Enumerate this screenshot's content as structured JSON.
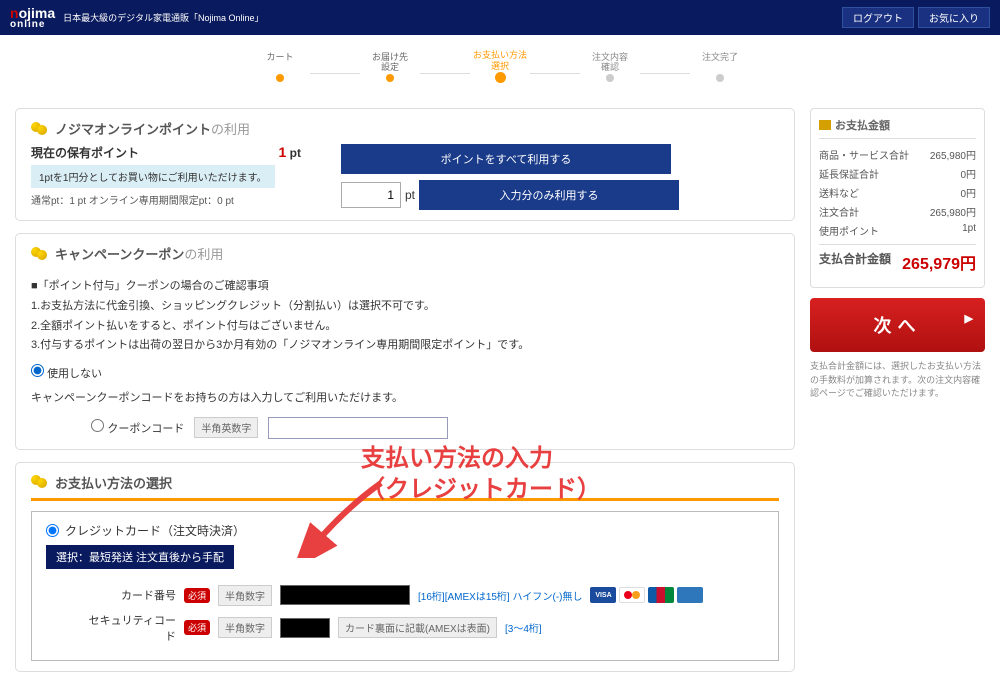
{
  "header": {
    "tagline": "日本最大級のデジタル家電通販「Nojima Online」",
    "logout": "ログアウト",
    "favorites": "お気に入り"
  },
  "progress": {
    "steps": [
      "カート",
      "お届け先\n設定",
      "お支払い方法\n選択",
      "注文内容\n確認",
      "注文完了"
    ]
  },
  "points": {
    "title_main": "ノジマオンラインポイント",
    "title_suffix": "の利用",
    "current_label": "現在の保有ポイント",
    "current_value": "1",
    "pt_unit": "pt",
    "note": "1ptを1円分としてお買い物にご利用いただけます。",
    "small": "通常pt：1 pt オンライン専用期間限定pt：0 pt",
    "use_all_btn": "ポイントをすべて利用する",
    "input_value": "1",
    "use_input_btn": "入力分のみ利用する"
  },
  "coupon": {
    "title_main": "キャンペーンクーポン",
    "title_suffix": "の利用",
    "note_header": "■「ポイント付与」クーポンの場合のご確認事項",
    "note1": "1.お支払方法に代金引換、ショッピングクレジット（分割払い）は選択不可です。",
    "note2": "2.全額ポイント払いをすると、ポイント付与はございません。",
    "note3": "3.付与するポイントは出荷の翌日から3か月有効の「ノジマオンライン専用期間限定ポイント」です。",
    "radio_none": "使用しない",
    "coupon_prompt": "キャンペーンクーポンコードをお持ちの方は入力してご利用いただけます。",
    "coupon_label": "クーポンコード",
    "badge_alnum": "半角英数字"
  },
  "payment": {
    "title": "お支払い方法の選択",
    "cc_label": "クレジットカード（注文時決済）",
    "sel_bar": "選択：最短発送 注文直後から手配",
    "card_no_label": "カード番号",
    "required": "必須",
    "badge_num": "半角数字",
    "hint_digits": "[16桁][AMEXは15桁] ハイフン(-)無し",
    "sec_label": "セキュリティコード",
    "sec_hint_box": "カード裏面に記載(AMEXは表面)",
    "sec_hint": "[3～4桁]"
  },
  "sidebar": {
    "header": "お支払金額",
    "rows": [
      {
        "label": "商品・サービス合計",
        "val": "265,980円"
      },
      {
        "label": "延長保証合計",
        "val": "0円"
      },
      {
        "label": "送料など",
        "val": "0円"
      },
      {
        "label": "注文合計",
        "val": "265,980円"
      },
      {
        "label": "使用ポイント",
        "val": "1pt"
      }
    ],
    "total_label": "支払合計金額",
    "total_val": "265,979円",
    "next_btn": "次へ",
    "note": "支払合計金額には、選択したお支払い方法の手数料が加算されます。次の注文内容確認ページでご確認いただけます。"
  },
  "annotation": {
    "line1": "支払い方法の入力",
    "line2": "（クレジットカード）"
  }
}
